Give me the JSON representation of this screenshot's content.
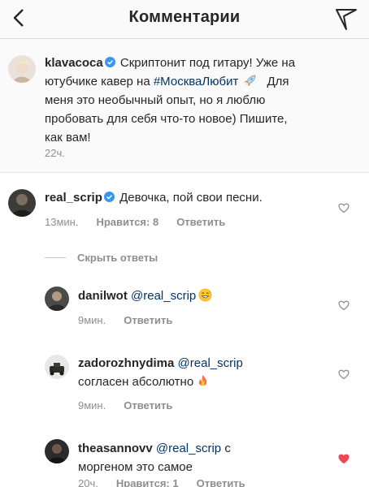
{
  "header": {
    "title": "Комментарии"
  },
  "caption": {
    "username": "klavacoca",
    "text_1": "Скриптонит под гитару! Уже на",
    "text_2": "ютубчике кавер на",
    "hashtag": "#МоскваЛюбит",
    "text_2b": "Для",
    "text_3": "меня это необычный опыт, но я люблю",
    "text_4": "пробовать для себя что-то новое) Пишите,",
    "text_5": "как вам!",
    "time": "22ч."
  },
  "comments": [
    {
      "username": "real_scrip",
      "text": "Девочка, пой свои песни.",
      "time": "13мин.",
      "likes": "Нравится: 8",
      "reply": "Ответить"
    }
  ],
  "toggle_replies": "Скрыть ответы",
  "replies": [
    {
      "username": "danilwot",
      "mention": "@real_scrip",
      "time": "9мин.",
      "reply": "Ответить"
    },
    {
      "username": "zadorozhnydima",
      "mention": "@real_scrip",
      "text": "согласен абсолютно",
      "time": "9мин.",
      "reply": "Ответить"
    },
    {
      "username": "theasannovv",
      "mention": "@real_scrip",
      "text_1": "с",
      "text_2": "моргеном это самое",
      "time": "20ч.",
      "likes": "Нравится: 1",
      "reply": "Ответить"
    }
  ],
  "colors": {
    "link": "#003569",
    "muted": "#8e8e8e",
    "verified": "#3897f0",
    "liked": "#ed4956"
  }
}
